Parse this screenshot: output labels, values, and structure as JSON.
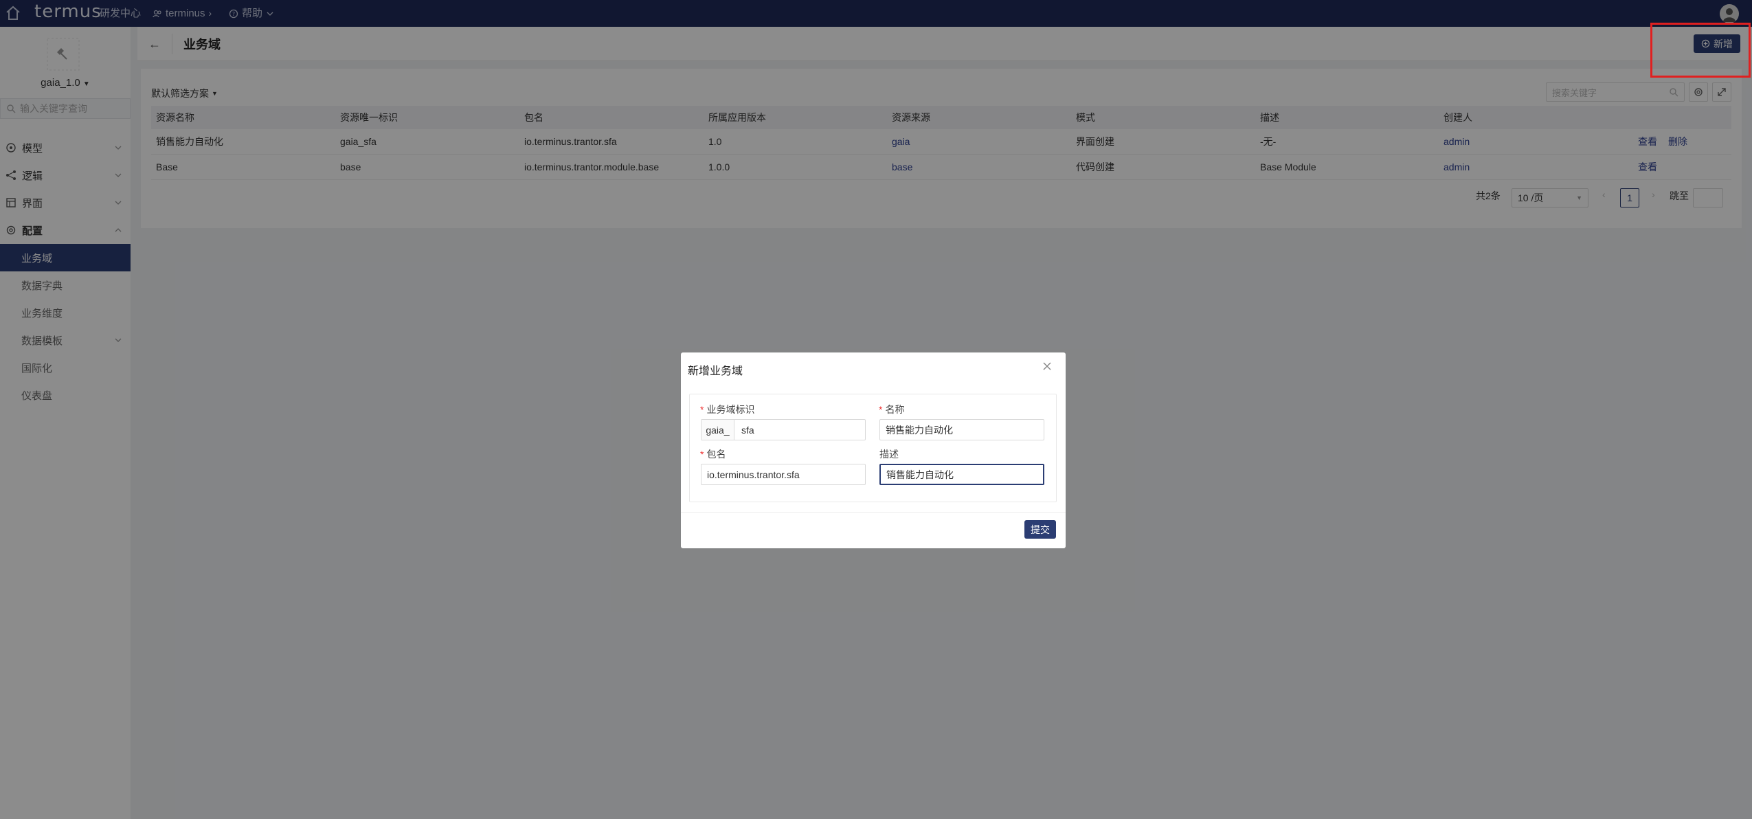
{
  "topbar": {
    "brand": "termus",
    "nav_dev_center": "研发中心",
    "nav_org": "terminus",
    "nav_help": "帮助"
  },
  "sidebar": {
    "app_version": "gaia_1.0",
    "search_placeholder": "输入关键字查询",
    "groups": [
      {
        "label": "模型",
        "icon": "cube-icon"
      },
      {
        "label": "逻辑",
        "icon": "flow-icon"
      },
      {
        "label": "界面",
        "icon": "layout-icon"
      },
      {
        "label": "配置",
        "icon": "gear-icon"
      }
    ],
    "sub_items": [
      "业务域",
      "数据字典",
      "业务维度",
      "数据模板",
      "国际化",
      "仪表盘"
    ]
  },
  "header": {
    "back_symbol": "←",
    "title": "业务域",
    "add_label": "新增"
  },
  "table": {
    "filter_scheme": "默认筛选方案",
    "search_placeholder": "搜索关键字",
    "columns": [
      "资源名称",
      "资源唯一标识",
      "包名",
      "所属应用版本",
      "资源来源",
      "模式",
      "描述",
      "创建人"
    ],
    "rows": [
      {
        "name": "销售能力自动化",
        "key": "gaia_sfa",
        "package": "io.terminus.trantor.sfa",
        "version": "1.0",
        "source": "gaia",
        "mode": "界面创建",
        "desc": "-无-",
        "creator": "admin",
        "ops": [
          "查看",
          "删除"
        ]
      },
      {
        "name": "Base",
        "key": "base",
        "package": "io.terminus.trantor.module.base",
        "version": "1.0.0",
        "source": "base",
        "mode": "代码创建",
        "desc": "Base Module",
        "creator": "admin",
        "ops": [
          "查看"
        ]
      }
    ],
    "pagination": {
      "total": "共2条",
      "page_size": "10 /页",
      "current_page": "1",
      "jump_label": "跳至"
    }
  },
  "modal": {
    "title": "新增业务域",
    "fields": {
      "domain_key_label": "业务域标识",
      "domain_key_prefix": "gaia_",
      "domain_key_value": "sfa",
      "name_label": "名称",
      "name_value": "销售能力自动化",
      "package_label": "包名",
      "package_value": "io.terminus.trantor.sfa",
      "desc_label": "描述",
      "desc_value": "销售能力自动化"
    },
    "submit_label": "提交"
  },
  "colors": {
    "topbar": "#1f2b5a",
    "primary": "#2b3d73",
    "highlight": "#e02020"
  }
}
